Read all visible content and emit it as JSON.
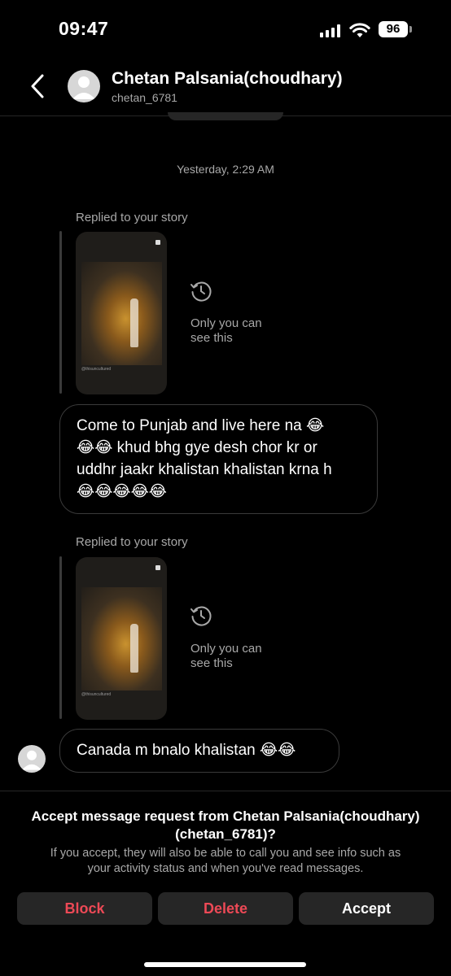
{
  "status_bar": {
    "time": "09:47",
    "battery": "96"
  },
  "header": {
    "name": "Chetan Palsania(choudhary)",
    "username": "chetan_6781"
  },
  "thread": {
    "timestamp": "Yesterday, 2:29 AM",
    "story_replies": [
      {
        "label": "Replied to your story",
        "only_you_line1": "Only you can",
        "only_you_line2": "see this",
        "thumb_handle": "@thisuncultured"
      },
      {
        "label": "Replied to your story",
        "only_you_line1": "Only you can",
        "only_you_line2": "see this",
        "thumb_handle": "@thisuncultured"
      }
    ],
    "messages": [
      {
        "lines": [
          "Come to Punjab and live here na 😂",
          "😂😂 khud bhg gye desh chor kr or",
          "uddhr jaakr khalistan khalistan krna h",
          "😂😂😂😂😂"
        ]
      },
      {
        "lines": [
          "Canada m bnalo khalistan 😂😂"
        ]
      }
    ]
  },
  "request": {
    "title_line1": "Accept message request from Chetan Palsania(choudhary)",
    "title_line2": "(chetan_6781)?",
    "body_line1": "If you accept, they will also be able to call you and see info such as",
    "body_line2": "your activity status and when you've read messages.",
    "block_label": "Block",
    "delete_label": "Delete",
    "accept_label": "Accept",
    "destructive_color": "#ed4956"
  }
}
